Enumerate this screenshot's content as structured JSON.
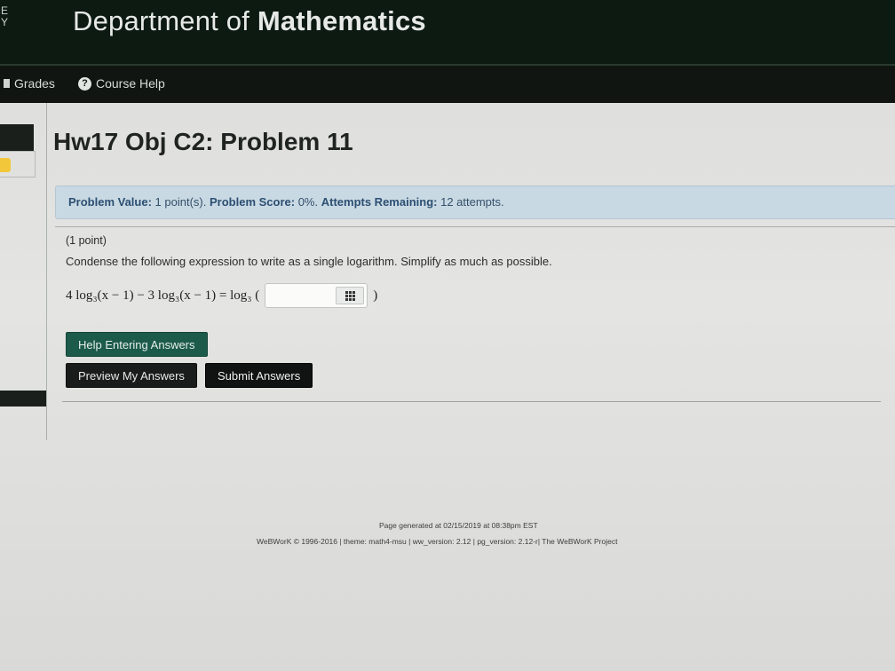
{
  "header": {
    "initials": "E\nY",
    "title_prefix": "Department of ",
    "title_bold": "Mathematics"
  },
  "nav": {
    "items": [
      {
        "label": "Grades",
        "icon": "grades-icon"
      },
      {
        "label": "Course Help",
        "icon": "help-circle-icon"
      }
    ]
  },
  "problem": {
    "title": "Hw17 Obj C2: Problem 11",
    "info": {
      "value_label": "Problem Value:",
      "value_text": "1 point(s).",
      "score_label": "Problem Score:",
      "score_text": "0%.",
      "attempts_label": "Attempts Remaining:",
      "attempts_text": "12 attempts."
    },
    "points": "(1 point)",
    "instruction": "Condense the following expression to write as a single logarithm. Simplify as much as possible.",
    "equation": "4 log₃(x − 1) − 3 log₃(x − 1) = log₃ (",
    "equation_close": ")",
    "answer_value": ""
  },
  "buttons": {
    "help": "Help Entering Answers",
    "preview": "Preview My Answers",
    "submit": "Submit Answers"
  },
  "footer": {
    "generated": "Page generated at 02/15/2019 at 08:38pm EST",
    "credits": "WeBWorK © 1996-2016 | theme: math4-msu | ww_version: 2.12 | pg_version: 2.12-r| The WeBWorK Project"
  },
  "colors": {
    "header_bg": "#0c1a12",
    "nav_bg": "#111511",
    "info_bg": "#c9d9e3",
    "help_button": "#1c5a4a",
    "submit_button": "#111312"
  }
}
